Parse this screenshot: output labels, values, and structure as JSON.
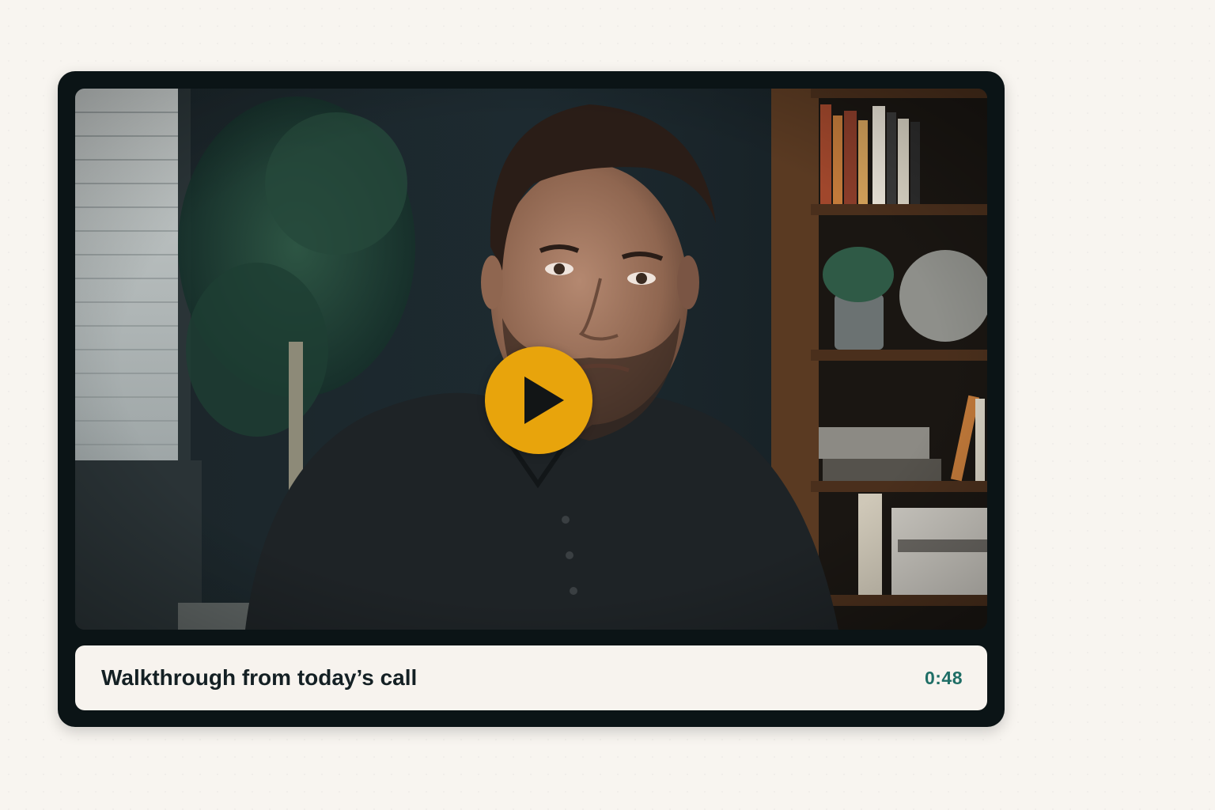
{
  "video_card": {
    "title": "Walkthrough from today’s call",
    "duration": "0:48"
  },
  "icons": {
    "play": "play-icon"
  },
  "colors": {
    "page_background": "#f8f5f0",
    "card_frame": "#0b1416",
    "play_button": "#e8a40c",
    "caption_background": "#f7f3ee",
    "title_text": "#142024",
    "duration_text": "#1f6e66"
  }
}
